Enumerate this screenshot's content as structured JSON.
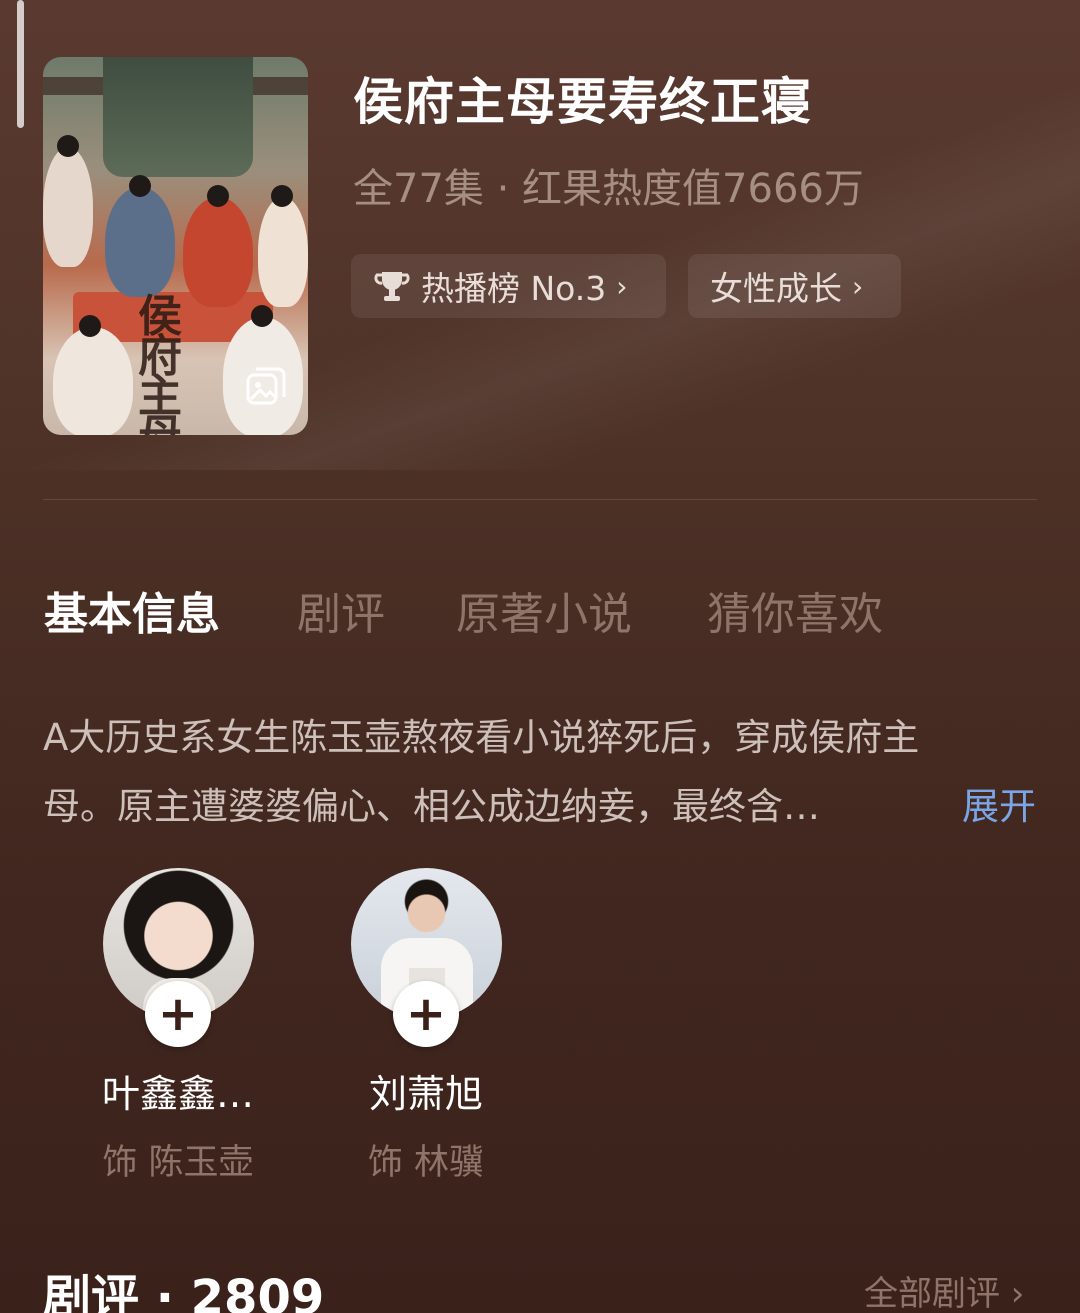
{
  "drama": {
    "title": "侯府主母要寿终正寝",
    "meta": "全77集 · 红果热度值7666万",
    "poster_calligraphy": "侯府主母"
  },
  "tags": [
    {
      "label": "热播榜 No.3",
      "icon": "trophy-icon",
      "chevron": "›"
    },
    {
      "label": "女性成长",
      "chevron": "›"
    }
  ],
  "tabs": [
    {
      "label": "基本信息",
      "active": true
    },
    {
      "label": "剧评",
      "active": false
    },
    {
      "label": "原著小说",
      "active": false
    },
    {
      "label": "猜你喜欢",
      "active": false
    }
  ],
  "synopsis": {
    "line1": "A大历史系女生陈玉壶熬夜看小说猝死后，穿成侯府主",
    "line2": "母。原主遭婆婆偏心、相公成边纳妾，最终含…",
    "expand_label": "展开"
  },
  "cast": [
    {
      "name": "叶鑫鑫…",
      "role": "饰  陈玉壶",
      "follow": "+"
    },
    {
      "name": "刘萧旭",
      "role": "饰  林骥",
      "follow": "+"
    }
  ],
  "reviews": {
    "title": "剧评 · 2809",
    "all_label": "全部剧评 ›"
  },
  "colors": {
    "background": "#4d3127",
    "accent_link": "#7aa6e8",
    "muted_text": "#8f7469"
  }
}
